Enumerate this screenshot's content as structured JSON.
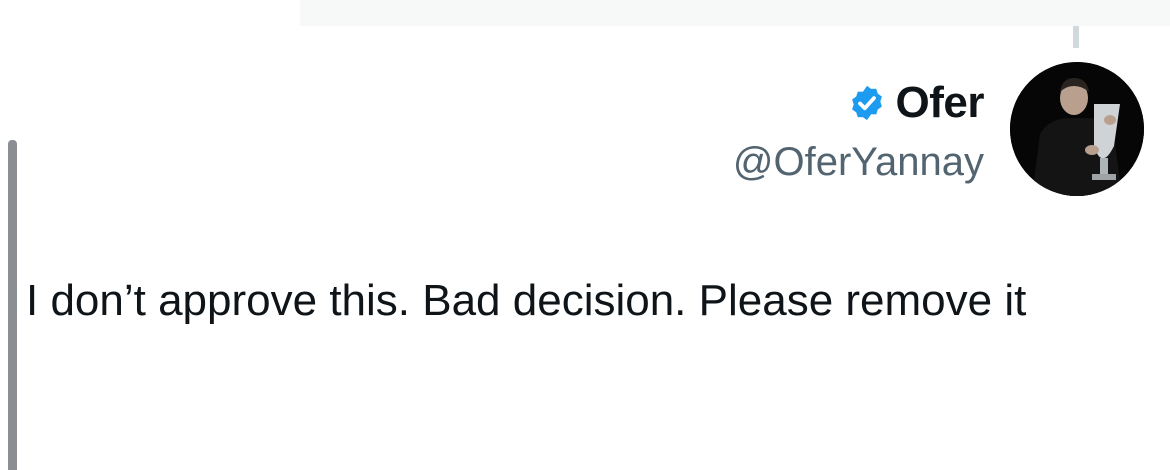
{
  "tweet": {
    "author": {
      "display_name": "Ofer",
      "handle": "@OferYannay",
      "verified_icon": "verified-badge-icon",
      "badge_color": "#1d9bf0",
      "avatar_icon": "profile-photo"
    },
    "text": "I don’t approve this. Bad decision. Please remove it"
  }
}
